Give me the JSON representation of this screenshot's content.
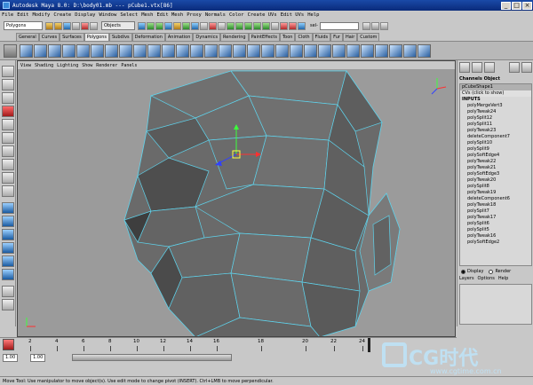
{
  "window": {
    "title": "Autodesk Maya 8.0: D:\\body01.mb   ---   pCube1.vtx[86]"
  },
  "menu": [
    "File",
    "Edit",
    "Modify",
    "Create",
    "Display",
    "Window",
    "Select",
    "Mesh",
    "Edit Mesh",
    "Proxy",
    "Normals",
    "Color",
    "Create UVs",
    "Edit UVs",
    "Help"
  ],
  "statusline": {
    "menuset": "Polygons",
    "objects": "Objects",
    "sel_label": "sel-"
  },
  "shelf_tabs": [
    "General",
    "Curves",
    "Surfaces",
    "Polygons",
    "Subdivs",
    "Deformation",
    "Animation",
    "Dynamics",
    "Rendering",
    "PaintEffects",
    "Toon",
    "Cloth",
    "Fluids",
    "Fur",
    "Hair",
    "Custom"
  ],
  "shelf_active_tab": "Polygons",
  "panel_menu": [
    "View",
    "Shading",
    "Lighting",
    "Show",
    "Renderer",
    "Panels"
  ],
  "viewport": {
    "selected_component": "pCube1.vtx[86]",
    "axis_labels": {
      "x": "x",
      "y": "y",
      "z": "z"
    }
  },
  "channel_box": {
    "menu": [
      "Channels",
      "Object"
    ],
    "shape": "pCubeShape1",
    "cvs_hint": "CVs (click to show)",
    "inputs_label": "INPUTS",
    "inputs": [
      "polyMergeVert3",
      "polyTweak24",
      "polySplit12",
      "polySplit11",
      "polyTweak23",
      "deleteComponent7",
      "polySplit10",
      "polySplit9",
      "polySoftEdge4",
      "polyTweak22",
      "polyTweak21",
      "polySoftEdge3",
      "polyTweak20",
      "polySplit8",
      "polyTweak19",
      "deleteComponent6",
      "polyTweak18",
      "polySplit7",
      "polyTweak17",
      "polySplit6",
      "polySplit5",
      "polyTweak16",
      "polySoftEdge2"
    ],
    "display": {
      "label": "Display",
      "render": "Render",
      "selected": "Display"
    },
    "layer_menu": [
      "Layers",
      "Options",
      "Help"
    ]
  },
  "time_slider": {
    "ticks": [
      "2",
      "4",
      "6",
      "8",
      "10",
      "12",
      "14",
      "16",
      "18",
      "20",
      "22",
      "24"
    ],
    "current_frame": "24"
  },
  "range_slider": {
    "start": "1.00",
    "inner_start": "1.00"
  },
  "help_line": "Move Tool: Use manipulator to move object(s). Use edit mode to change pivot (INSERT). Ctrl+LMB to move perpendicular.",
  "watermark": {
    "logo": "CG时代",
    "url": "www.cgtime.com.cn"
  }
}
